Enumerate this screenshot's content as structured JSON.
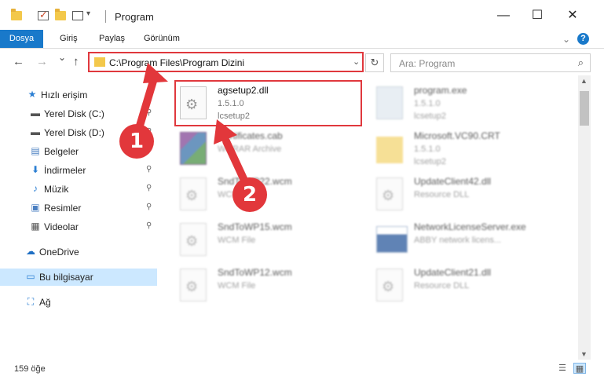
{
  "window": {
    "title": "Program",
    "minimize": "—",
    "maximize": "☐",
    "close": "✕"
  },
  "ribbon": {
    "tabs": [
      "Dosya",
      "Giriş",
      "Paylaş",
      "Görünüm"
    ],
    "expand_icon": "chevron-down-icon",
    "help": "?"
  },
  "nav": {
    "back": "←",
    "forward": "→",
    "recent": "⌄",
    "up": "↑",
    "address": "C:\\Program Files\\Program Dizini",
    "refresh": "↻",
    "search_placeholder": "Ara: Program",
    "search_icon": "⌕"
  },
  "sidebar": {
    "items": [
      {
        "label": "Hızlı erişim",
        "icon": "star-icon",
        "glyph": "★",
        "color": "#2c7fd3"
      },
      {
        "label": "Yerel Disk (C:)",
        "icon": "drive-icon",
        "glyph": "▬",
        "color": "#555555",
        "pinned": true
      },
      {
        "label": "Yerel Disk (D:)",
        "icon": "drive-icon",
        "glyph": "▬",
        "color": "#555555",
        "pinned": true
      },
      {
        "label": "Belgeler",
        "icon": "documents-icon",
        "glyph": "▤",
        "color": "#4a7fc1",
        "pinned": true
      },
      {
        "label": "İndirmeler",
        "icon": "download-icon",
        "glyph": "⬇",
        "color": "#2c7fd3",
        "pinned": true
      },
      {
        "label": "Müzik",
        "icon": "music-icon",
        "glyph": "♪",
        "color": "#2c7fd3",
        "pinned": true
      },
      {
        "label": "Resimler",
        "icon": "pictures-icon",
        "glyph": "▣",
        "color": "#4a7fc1",
        "pinned": true
      },
      {
        "label": "Videolar",
        "icon": "video-icon",
        "glyph": "▦",
        "color": "#555555",
        "pinned": true
      },
      {
        "label": "OneDrive",
        "icon": "cloud-icon",
        "glyph": "☁",
        "color": "#1f6fc4"
      },
      {
        "label": "Bu bilgisayar",
        "icon": "computer-icon",
        "glyph": "▭",
        "color": "#2c7fd3",
        "selected": true
      },
      {
        "label": "Ağ",
        "icon": "network-icon",
        "glyph": "⛶",
        "color": "#2c7fd3"
      }
    ],
    "pin_glyph": "📌"
  },
  "files": [
    {
      "name": "agsetup2.dll",
      "line2": "1.5.1.0",
      "line3": "lcsetup2",
      "kind": "dll",
      "faded": false
    },
    {
      "name": "program.exe",
      "line2": "1.5.1.0",
      "line3": "lcsetup2",
      "kind": "exe",
      "faded": true
    },
    {
      "name": "Certificates.cab",
      "line2": "WinRAR Archive",
      "line3": "",
      "kind": "rar",
      "faded": true
    },
    {
      "name": "Microsoft.VC90.CRT",
      "line2": "1.5.1.0",
      "line3": "lcsetup2",
      "kind": "folder",
      "faded": true
    },
    {
      "name": "SndToWP22.wcm",
      "line2": "WCM File",
      "line3": "",
      "kind": "dll",
      "faded": true
    },
    {
      "name": "UpdateClient42.dll",
      "line2": "Resource DLL",
      "line3": "",
      "kind": "dll",
      "faded": true
    },
    {
      "name": "SndToWP15.wcm",
      "line2": "WCM File",
      "line3": "",
      "kind": "dll",
      "faded": true
    },
    {
      "name": "NetworkLicenseServer.exe",
      "line2": "ABBY network licens...",
      "line3": "",
      "kind": "net",
      "faded": true
    },
    {
      "name": "SndToWP12.wcm",
      "line2": "WCM File",
      "line3": "",
      "kind": "dll",
      "faded": true
    },
    {
      "name": "UpdateClient21.dll",
      "line2": "Resource DLL",
      "line3": "",
      "kind": "dll",
      "faded": true
    }
  ],
  "status": {
    "item_count": "159 öğe",
    "details_view": "☰",
    "icons_view": "▦"
  },
  "annotations": {
    "step1": "1",
    "step2": "2",
    "color": "#e2373b"
  }
}
